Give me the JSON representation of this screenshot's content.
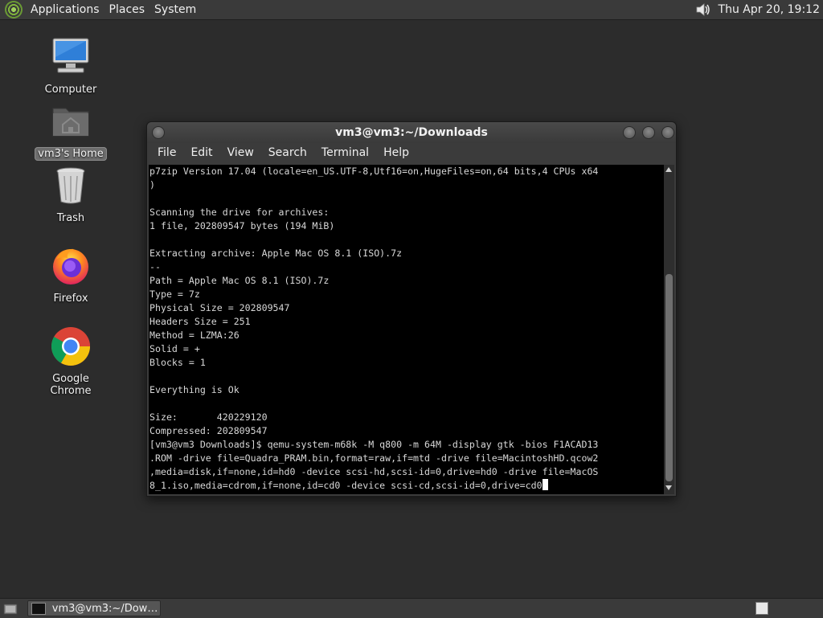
{
  "top_panel": {
    "menus": [
      "Applications",
      "Places",
      "System"
    ],
    "clock": "Thu Apr 20, 19:12",
    "icons": {
      "logo": "mate-logo-icon",
      "volume": "volume-icon"
    }
  },
  "desktop": {
    "icons": [
      {
        "label": "Computer",
        "icon": "computer-icon"
      },
      {
        "label": "vm3's Home",
        "icon": "home-folder-icon",
        "selected": true
      },
      {
        "label": "Trash",
        "icon": "trash-icon"
      },
      {
        "label": "Firefox",
        "icon": "firefox-icon"
      },
      {
        "label": "Google Chrome",
        "icon": "chrome-icon"
      }
    ]
  },
  "window": {
    "title": "vm3@vm3:~/Downloads",
    "menus": [
      "File",
      "Edit",
      "View",
      "Search",
      "Terminal",
      "Help"
    ],
    "terminal_lines": [
      "p7zip Version 17.04 (locale=en_US.UTF-8,Utf16=on,HugeFiles=on,64 bits,4 CPUs x64",
      ")",
      "",
      "Scanning the drive for archives:",
      "1 file, 202809547 bytes (194 MiB)",
      "",
      "Extracting archive: Apple Mac OS 8.1 (ISO).7z",
      "--",
      "Path = Apple Mac OS 8.1 (ISO).7z",
      "Type = 7z",
      "Physical Size = 202809547",
      "Headers Size = 251",
      "Method = LZMA:26",
      "Solid = +",
      "Blocks = 1",
      "",
      "Everything is Ok",
      "",
      "Size:       420229120",
      "Compressed: 202809547",
      "[vm3@vm3 Downloads]$ qemu-system-m68k -M q800 -m 64M -display gtk -bios F1ACAD13",
      ".ROM -drive file=Quadra_PRAM.bin,format=raw,if=mtd -drive file=MacintoshHD.qcow2",
      ",media=disk,if=none,id=hd0 -device scsi-hd,scsi-id=0,drive=hd0 -drive file=MacOS",
      "8_1.iso,media=cdrom,if=none,id=cd0 -device scsi-cd,scsi-id=0,drive=cd0"
    ]
  },
  "bottom_panel": {
    "task_label": "vm3@vm3:~/Downl...",
    "icons": {
      "show_desktop": "show-desktop-icon",
      "terminal": "terminal-icon",
      "workspace": "workspace-switcher-icon"
    }
  }
}
